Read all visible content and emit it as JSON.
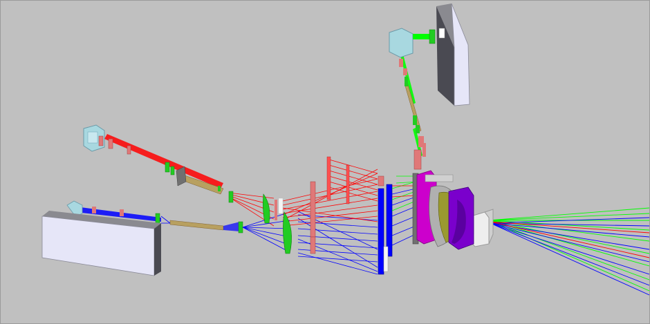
{
  "scene": {
    "background": "#c0c0c0",
    "colors": {
      "red_beam": "#ff0000",
      "blue_beam": "#0000ff",
      "green_beam": "#00ff00",
      "orange_beam": "#ff8000",
      "yellow_beam": "#c8c800",
      "lens_green": "#22cc22",
      "lens_pink": "#e07878",
      "lens_magenta": "#cc00cc",
      "lens_purple": "#7a00cc",
      "lens_olive": "#9a9a30",
      "box_face": "#e6e6f8",
      "box_top": "#8a8a90",
      "box_side": "#4a4a52",
      "detector_cyan": "#a8d8e0"
    },
    "components": [
      "red-channel-detector",
      "blue-channel-detector-housing",
      "green-channel-detector-housing",
      "dichroic-splitter",
      "collimator-lens-array",
      "telescope-optics",
      "output-window"
    ]
  }
}
